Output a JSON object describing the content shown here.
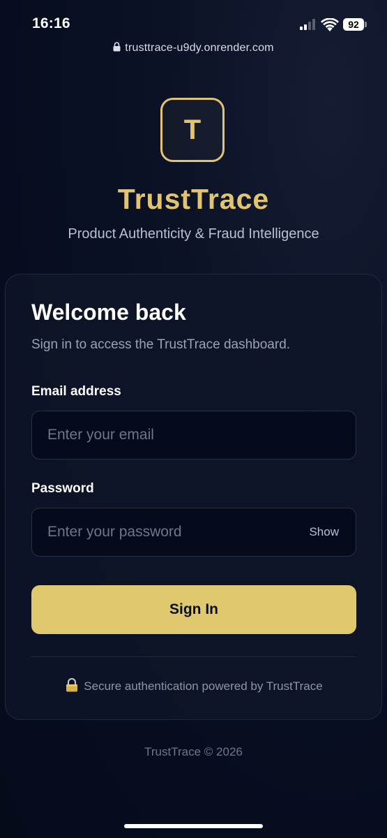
{
  "status_bar": {
    "time": "16:16",
    "battery": "92"
  },
  "browser": {
    "url": "trusttrace-u9dy.onrender.com"
  },
  "brand": {
    "logo_letter": "T",
    "title": "TrustTrace",
    "subtitle": "Product Authenticity & Fraud Intelligence",
    "accent_color": "#e3c46e"
  },
  "login": {
    "heading": "Welcome back",
    "subheading": "Sign in to access the TrustTrace dashboard.",
    "email_label": "Email address",
    "email_placeholder": "Enter your email",
    "email_value": "",
    "password_label": "Password",
    "password_placeholder": "Enter your password",
    "password_value": "",
    "show_label": "Show",
    "submit_label": "Sign In",
    "secure_note": "Secure authentication powered by TrustTrace"
  },
  "footer": {
    "text": "TrustTrace © 2026"
  }
}
